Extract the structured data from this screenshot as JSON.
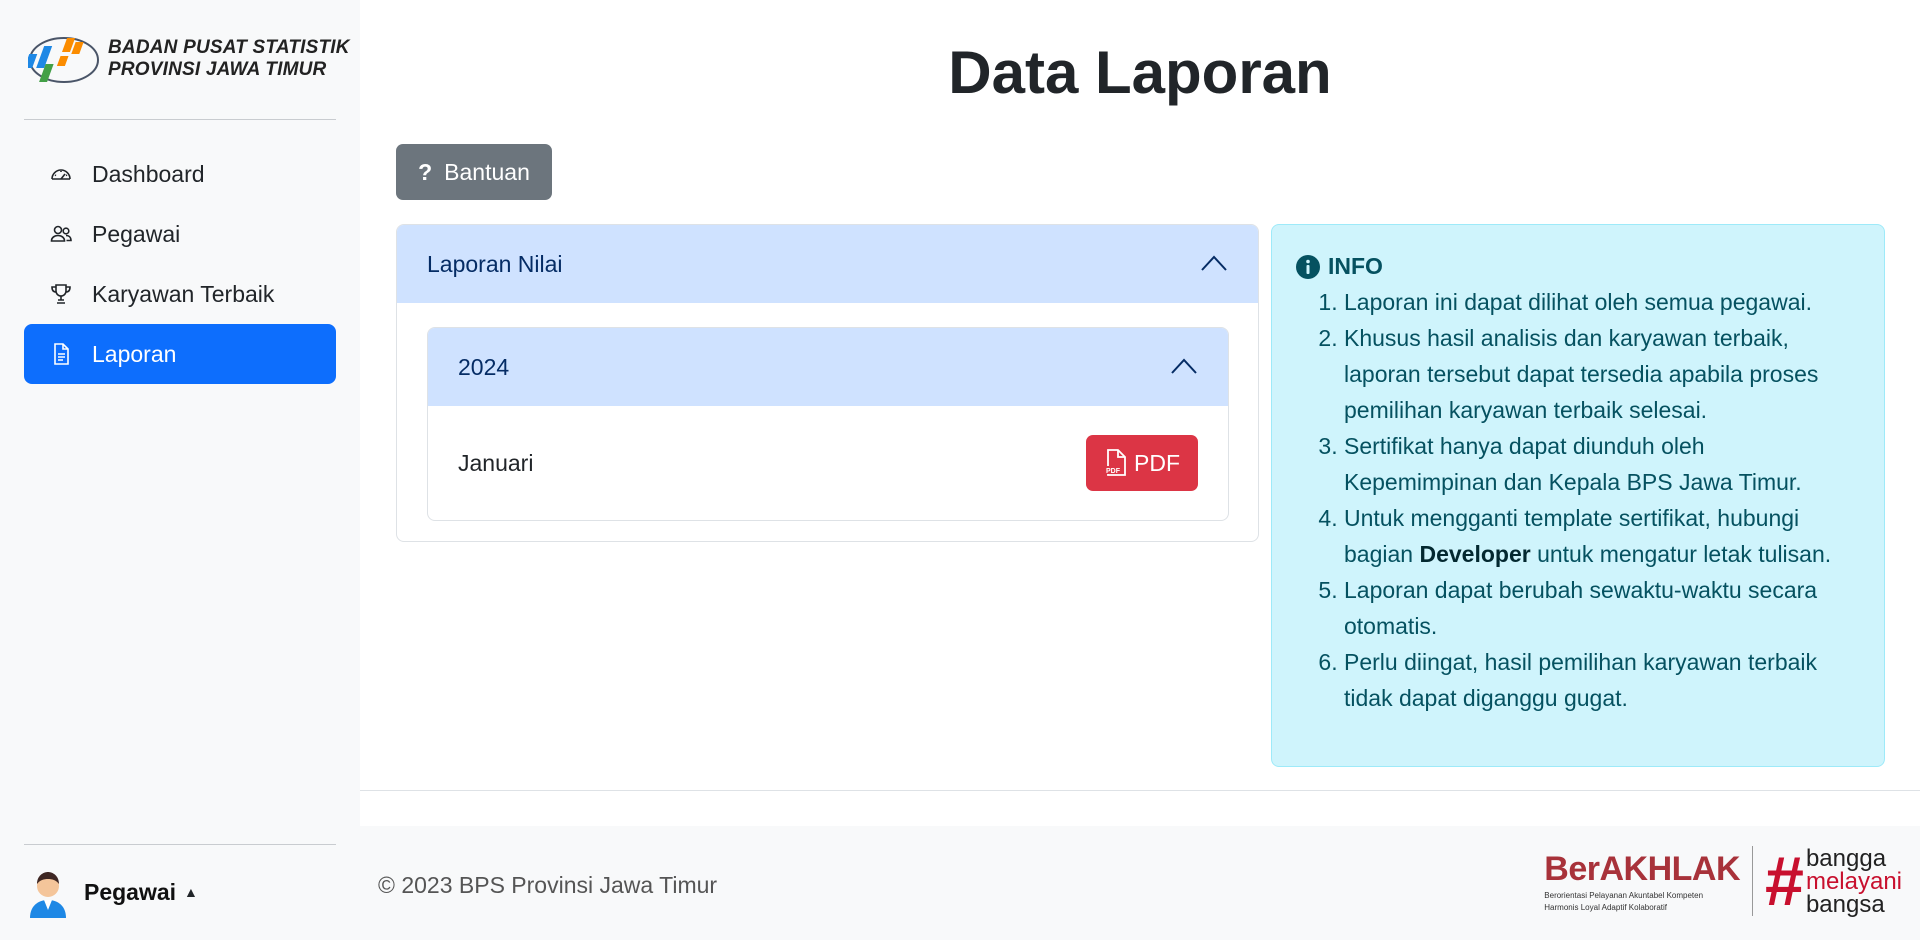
{
  "sidebar": {
    "brand": {
      "line1": "BADAN PUSAT STATISTIK",
      "line2": "PROVINSI JAWA TIMUR"
    },
    "items": [
      {
        "label": "Dashboard",
        "icon": "speedometer-icon"
      },
      {
        "label": "Pegawai",
        "icon": "people-icon"
      },
      {
        "label": "Karyawan Terbaik",
        "icon": "trophy-icon"
      },
      {
        "label": "Laporan",
        "icon": "file-text-icon",
        "active": true
      }
    ],
    "user": {
      "name": "Pegawai",
      "caret": "▲"
    }
  },
  "main": {
    "title": "Data Laporan",
    "help_button": {
      "icon": "?",
      "label": "Bantuan"
    },
    "accordion": {
      "header": "Laporan Nilai",
      "year": "2024",
      "row": {
        "month": "Januari",
        "pdf_label": "PDF"
      }
    },
    "info": {
      "title": "INFO",
      "items": [
        "Laporan ini dapat dilihat oleh semua pegawai.",
        "Khusus hasil analisis dan karyawan terbaik, laporan tersebut dapat tersedia apabila proses pemilihan karyawan terbaik selesai.",
        "Sertifikat hanya dapat diunduh oleh Kepemimpinan dan Kepala BPS Jawa Timur.",
        {
          "before": "Untuk mengganti template sertifikat, hubungi bagian ",
          "bold": "Developer",
          "after": " untuk mengatur letak tulisan."
        },
        "Laporan dapat berubah sewaktu-waktu secara otomatis.",
        "Perlu diingat, hasil pemilihan karyawan terbaik tidak dapat diganggu gugat."
      ]
    }
  },
  "footer": {
    "copyright": "© 2023 BPS Provinsi Jawa Timur",
    "logo1": {
      "name": "BerAKHLAK",
      "sub1": "Berorientasi Pelayanan Akuntabel Kompeten",
      "sub2": "Harmonis Loyal Adaptif Kolaboratif"
    },
    "logo2": {
      "hash": "#",
      "line1": "bangga",
      "line2": "melayani",
      "line3": "bangsa"
    }
  },
  "colors": {
    "primary": "#0d6efd",
    "secondary": "#6c757d",
    "danger": "#dc3545",
    "accordion_head": "#cfe2ff",
    "info_bg": "#cff4fc",
    "info_text": "#055160"
  }
}
